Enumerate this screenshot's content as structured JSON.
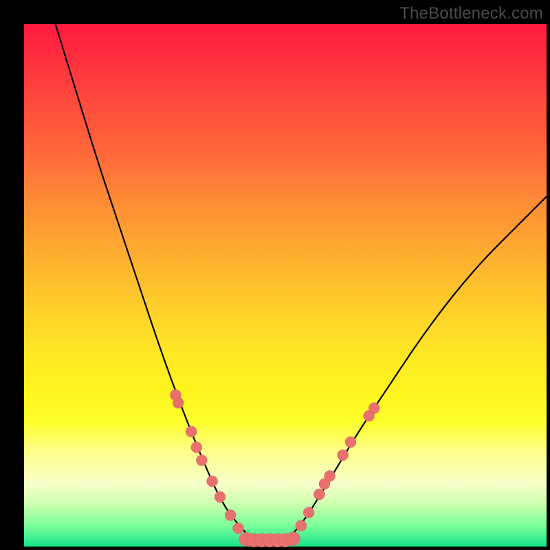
{
  "watermark": "TheBottleneck.com",
  "colors": {
    "frame": "#000000",
    "curve_stroke": "#000000",
    "marker_fill": "#e8716f",
    "marker_stroke": "#e05a58"
  },
  "chart_data": {
    "type": "line",
    "title": "",
    "xlabel": "",
    "ylabel": "",
    "xlim": [
      0,
      100
    ],
    "ylim": [
      0,
      100
    ],
    "grid": false,
    "legend": false,
    "annotations": [],
    "curve": [
      {
        "x": 6,
        "y": 100
      },
      {
        "x": 10,
        "y": 87
      },
      {
        "x": 14,
        "y": 74
      },
      {
        "x": 18,
        "y": 62
      },
      {
        "x": 22,
        "y": 50
      },
      {
        "x": 26,
        "y": 38
      },
      {
        "x": 30,
        "y": 27
      },
      {
        "x": 34,
        "y": 17
      },
      {
        "x": 38,
        "y": 8
      },
      {
        "x": 42,
        "y": 3
      },
      {
        "x": 44,
        "y": 1.2
      },
      {
        "x": 46,
        "y": 1.2
      },
      {
        "x": 48,
        "y": 1.2
      },
      {
        "x": 50,
        "y": 1.2
      },
      {
        "x": 53,
        "y": 4
      },
      {
        "x": 58,
        "y": 12
      },
      {
        "x": 64,
        "y": 22
      },
      {
        "x": 70,
        "y": 31
      },
      {
        "x": 76,
        "y": 40
      },
      {
        "x": 82,
        "y": 48
      },
      {
        "x": 88,
        "y": 55
      },
      {
        "x": 94,
        "y": 61
      },
      {
        "x": 100,
        "y": 67
      }
    ],
    "markers_left": [
      {
        "x": 29.0,
        "y": 29.0
      },
      {
        "x": 29.5,
        "y": 27.5
      },
      {
        "x": 32.0,
        "y": 22.0
      },
      {
        "x": 33.0,
        "y": 19.0
      },
      {
        "x": 34.0,
        "y": 16.5
      },
      {
        "x": 36.0,
        "y": 12.5
      },
      {
        "x": 37.5,
        "y": 9.5
      },
      {
        "x": 39.5,
        "y": 6.0
      },
      {
        "x": 41.0,
        "y": 3.5
      }
    ],
    "markers_bottom": [
      {
        "x": 42.5,
        "y": 1.4
      },
      {
        "x": 44.0,
        "y": 1.2
      },
      {
        "x": 45.5,
        "y": 1.2
      },
      {
        "x": 47.0,
        "y": 1.2
      },
      {
        "x": 48.5,
        "y": 1.2
      },
      {
        "x": 50.0,
        "y": 1.2
      },
      {
        "x": 51.5,
        "y": 1.5
      }
    ],
    "markers_right": [
      {
        "x": 53.0,
        "y": 4.0
      },
      {
        "x": 54.5,
        "y": 6.5
      },
      {
        "x": 56.5,
        "y": 10.0
      },
      {
        "x": 57.5,
        "y": 12.0
      },
      {
        "x": 58.5,
        "y": 13.5
      },
      {
        "x": 61.0,
        "y": 17.5
      },
      {
        "x": 62.5,
        "y": 20.0
      },
      {
        "x": 66.0,
        "y": 25.0
      },
      {
        "x": 67.0,
        "y": 26.5
      }
    ]
  }
}
